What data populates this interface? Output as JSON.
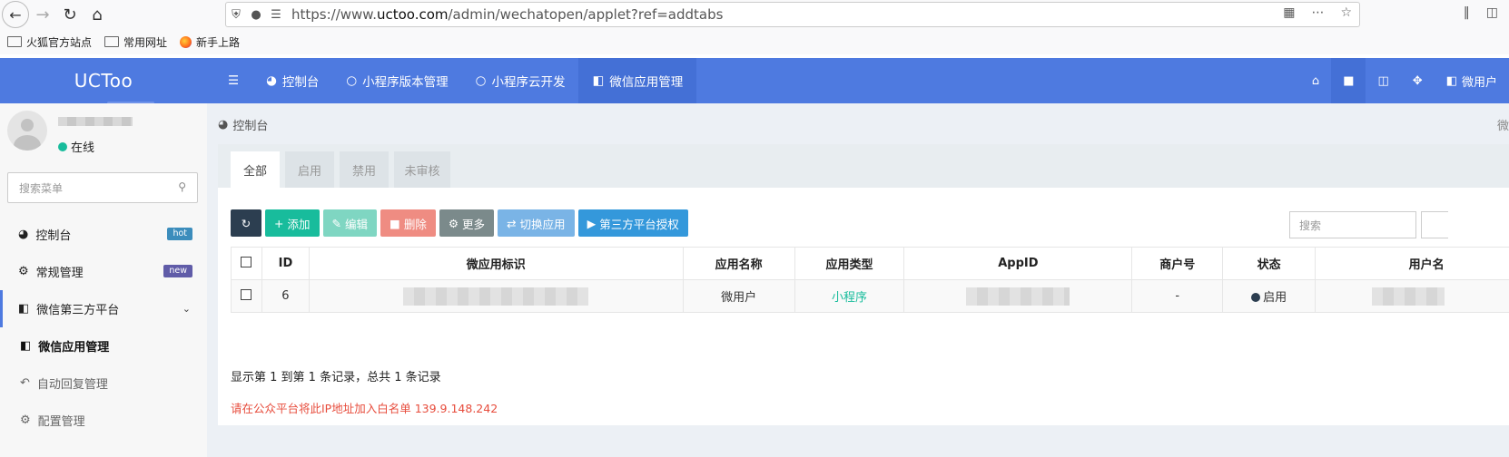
{
  "browser": {
    "url_prefix": "https://www.",
    "url_domain": "uctoo.com",
    "url_path": "/admin/wechatopen/applet?ref=addtabs"
  },
  "bookmarks": [
    {
      "label": "火狐官方站点",
      "icon": "folder-icon"
    },
    {
      "label": "常用网址",
      "icon": "folder-icon"
    },
    {
      "label": "新手上路",
      "icon": "firefox-icon"
    }
  ],
  "brand": "UCToo",
  "topnav": {
    "items": [
      {
        "label": "控制台",
        "icon": "dashboard-icon"
      },
      {
        "label": "小程序版本管理",
        "icon": "circle-icon"
      },
      {
        "label": "小程序云开发",
        "icon": "circle-icon"
      },
      {
        "label": "微信应用管理",
        "icon": "comments-icon"
      }
    ],
    "user_label": "微用户"
  },
  "sidebar": {
    "status": "在线",
    "search_placeholder": "搜索菜单",
    "menu": [
      {
        "label": "控制台",
        "badge": "hot",
        "badge_color": "#3c8dbc"
      },
      {
        "label": "常规管理",
        "badge": "new",
        "badge_color": "#605ca8"
      },
      {
        "label": "微信第三方平台"
      }
    ],
    "submenu": [
      {
        "label": "微信应用管理"
      },
      {
        "label": "自动回复管理"
      },
      {
        "label": "配置管理"
      }
    ]
  },
  "breadcrumb": {
    "label": "控制台",
    "right": "微"
  },
  "tabs": [
    "全部",
    "启用",
    "禁用",
    "未审核"
  ],
  "toolbar": {
    "add": "添加",
    "edit": "编辑",
    "delete": "删除",
    "more": "更多",
    "switch": "切换应用",
    "auth": "第三方平台授权"
  },
  "search_placeholder": "搜索",
  "table": {
    "headers": [
      "ID",
      "微应用标识",
      "应用名称",
      "应用类型",
      "AppID",
      "商户号",
      "状态",
      "用户名"
    ],
    "rows": [
      {
        "id": "6",
        "name": "微用户",
        "type": "小程序",
        "merchant": "-",
        "status": "启用"
      }
    ]
  },
  "pagination_info": "显示第 1 到第 1 条记录，总共 1 条记录",
  "ip_warning": "请在公众平台将此IP地址加入白名单 139.9.148.242",
  "colors": {
    "primary": "#4e7ae0",
    "success": "#18bc9c",
    "danger": "#e74c3c"
  }
}
